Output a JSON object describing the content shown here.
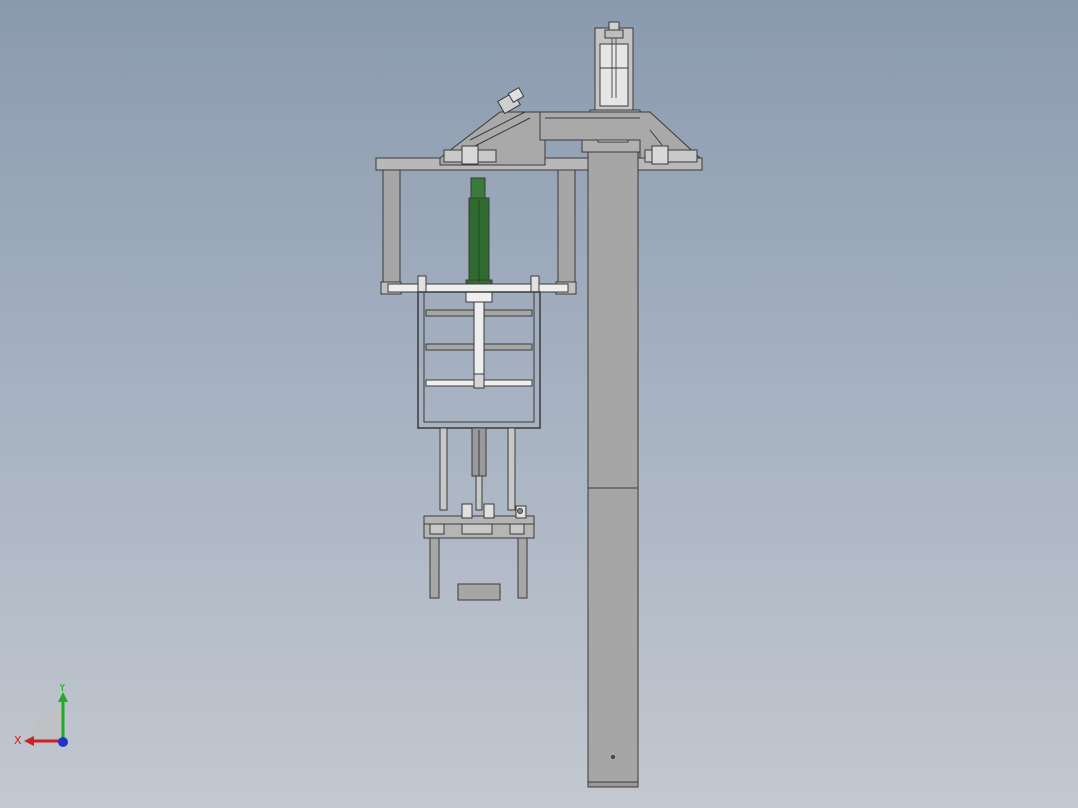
{
  "viewport": {
    "background_top": "#8a9aae",
    "background_bottom": "#c3c8d0"
  },
  "model": {
    "part_fill": "#a6a6a6",
    "part_fill_light": "#c8c8c8",
    "part_fill_white": "#eeeeee",
    "edge_color": "#3a3a3a",
    "cylinder_color": "#2f6b2f"
  },
  "triad": {
    "x_label": "X",
    "y_label": "Y",
    "x_color": "#cc2222",
    "y_color": "#22aa22",
    "z_color": "#2233cc"
  }
}
